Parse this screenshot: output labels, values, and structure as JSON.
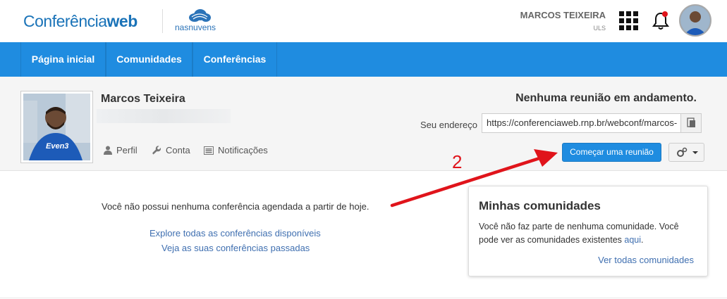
{
  "header": {
    "logo_regular": "Conferência",
    "logo_bold": "web",
    "partner_logo": "nasnuvens",
    "user_name": "MARCOS TEIXEIRA",
    "user_org": "ULS",
    "icons": [
      "apps-grid-icon",
      "bell-icon",
      "avatar"
    ],
    "notification_color": "#e0141b"
  },
  "nav": {
    "items": [
      {
        "label": "Página inicial"
      },
      {
        "label": "Comunidades"
      },
      {
        "label": "Conferências"
      }
    ],
    "color": "#1f8ce0"
  },
  "profile": {
    "name": "Marcos Teixeira",
    "links": [
      {
        "label": "Perfil",
        "icon": "user-icon"
      },
      {
        "label": "Conta",
        "icon": "wrench-icon"
      },
      {
        "label": "Notificações",
        "icon": "list-icon"
      }
    ],
    "status": "Nenhuma reunião em andamento.",
    "address_label": "Seu endereço",
    "address_value": "https://conferenciaweb.rnp.br/webconf/marcos-",
    "start_button": "Começar uma reunião",
    "settings_icon": "gears-icon"
  },
  "main": {
    "no_conferences": "Você não possui nenhuma conferência agendada a partir de hoje.",
    "explore_link": "Explore todas as conferências disponíveis",
    "past_link": "Veja as suas conferências passadas"
  },
  "communities": {
    "title": "Minhas comunidades",
    "text": "Você não faz parte de nenhuma comunidade. Você pode ver as comunidades existentes",
    "link_inline": "aqui",
    "see_all": "Ver todas comunidades"
  },
  "annotation": {
    "number": "2",
    "color": "#e0141b"
  }
}
